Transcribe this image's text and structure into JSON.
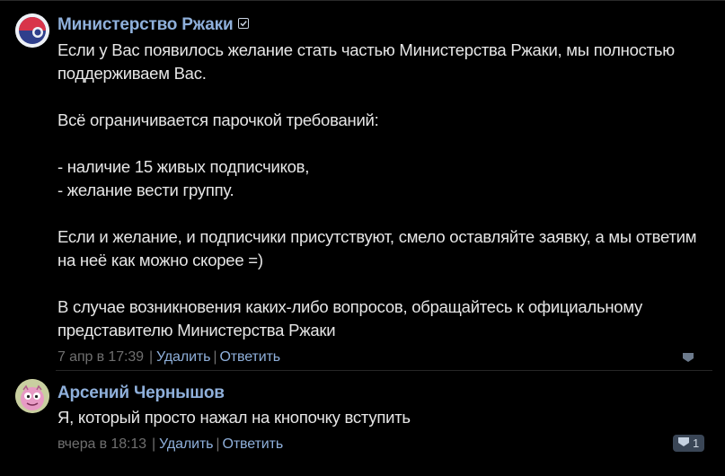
{
  "comments": [
    {
      "author": "Министерство Ржаки",
      "text": "Если у Вас появилось желание стать частью Министерства Ржаки, мы полностью поддерживаем Вас.\n\nВсё ограничивается парочкой требований:\n\n- наличие 15 живых подписчиков,\n- желание вести группу.\n\nЕсли и желание, и подписчики присутствуют, смело оставляйте заявку, а мы ответим на неё как можно скорее =)\n\nВ случае возникновения каких-либо вопросов, обращайтесь к официальному представителю Министерства Ржаки",
      "date": "7 апр в 17:39",
      "delete_label": "Удалить",
      "reply_label": "Ответить",
      "likes": ""
    },
    {
      "author": "Арсений Чернышов",
      "text": "Я, который просто нажал на кнопочку вступить",
      "date": "вчера в 18:13",
      "delete_label": "Удалить",
      "reply_label": "Ответить",
      "likes": "1"
    }
  ],
  "colors": {
    "background": "#000000",
    "author": "#8fb0db",
    "text": "#e6e6e6",
    "meta": "#6f6f6f",
    "like_badge": "#3a4656"
  },
  "icons": [
    "verified-icon",
    "like-icon"
  ]
}
